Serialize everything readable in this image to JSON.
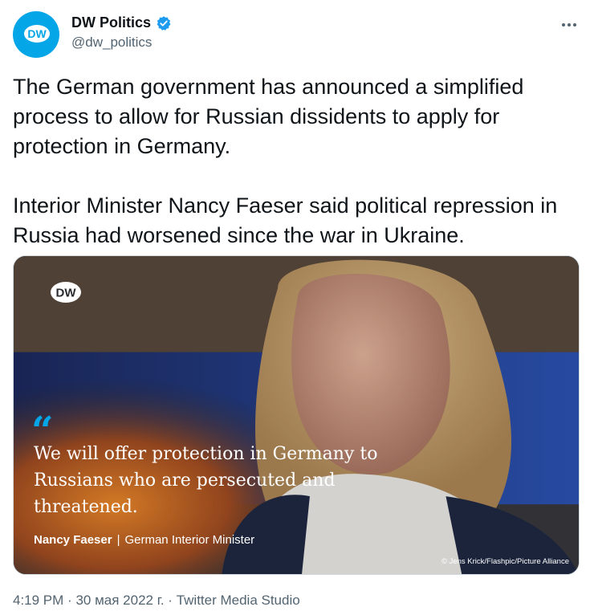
{
  "account": {
    "display_name": "DW Politics",
    "handle": "@dw_politics",
    "avatar_text": "DW"
  },
  "tweet": {
    "text": "The German government has announced a simplified process to allow for Russian dissidents to apply for protection in Germany.\n\nInterior Minister Nancy Faeser said political repression in Russia had worsened since the war in Ukraine."
  },
  "media": {
    "logo_text": "DW",
    "quote_mark": "“",
    "quote": "We will offer protection in Germany to Russians who are persecuted and threatened.",
    "speaker_name": "Nancy Faeser",
    "separator": "|",
    "speaker_title": "German Interior Minister",
    "credit": "© Jens Krick/Flashpic/Picture Alliance"
  },
  "meta": {
    "time": "4:19 PM",
    "date": "30 мая 2022 г.",
    "source": "Twitter Media Studio",
    "dot": "·"
  },
  "colors": {
    "brand_blue": "#05a6e8",
    "verified_blue": "#1d9bf0",
    "secondary_text": "#536471"
  }
}
